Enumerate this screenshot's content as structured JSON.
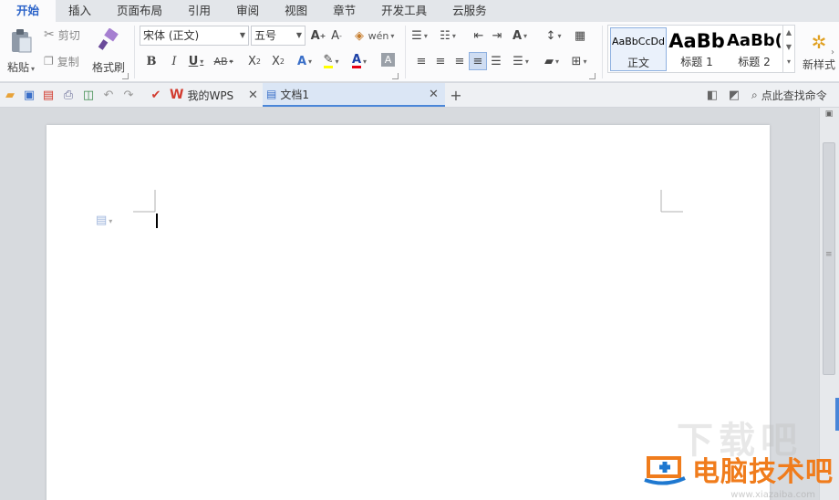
{
  "menu": {
    "tabs": [
      "开始",
      "插入",
      "页面布局",
      "引用",
      "审阅",
      "视图",
      "章节",
      "开发工具",
      "云服务"
    ],
    "active": "开始"
  },
  "clipboard": {
    "paste_label": "粘贴",
    "cut_label": "剪切",
    "copy_label": "复制",
    "format_painter_label": "格式刷"
  },
  "font": {
    "font_name": "宋体 (正文)",
    "font_size": "五号"
  },
  "styles": {
    "items": [
      {
        "preview": "AaBbCcDd",
        "label": "正文"
      },
      {
        "preview": "AaBb",
        "label": "标题 1"
      },
      {
        "preview": "AaBb(",
        "label": "标题 2"
      }
    ],
    "new_style_label": "新样式"
  },
  "quickbar": {
    "wps_tab_label": "我的WPS",
    "doc_tab_label": "文档1",
    "find_command_label": "点此查找命令"
  },
  "watermark": {
    "brand_text": "电脑技术吧",
    "ghost_text": "下载吧",
    "url_text": "www.xiazaiba.com"
  },
  "colors": {
    "accent": "#2b63c9",
    "highlight": "#ffff00",
    "font_color": "#e60012",
    "watermark": "#f07c1c"
  }
}
